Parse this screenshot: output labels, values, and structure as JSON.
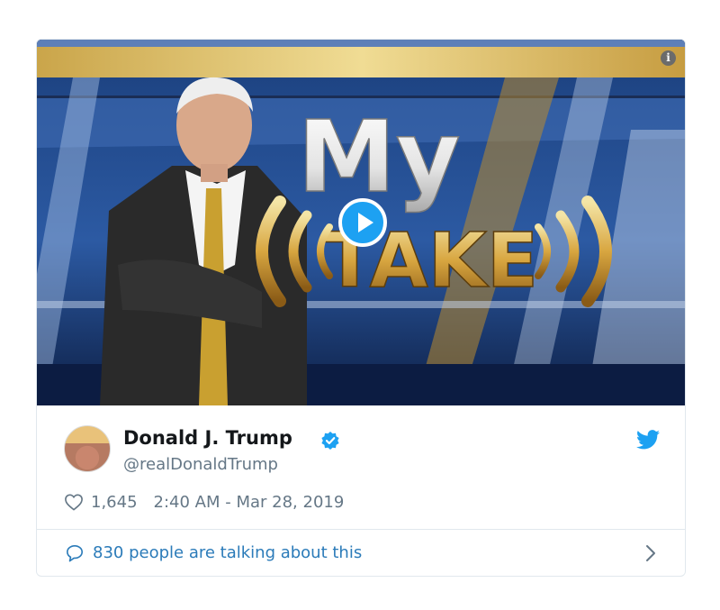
{
  "media": {
    "title_line1": "My",
    "title_line2": "TAKE",
    "info_icon": "info-icon",
    "play_icon": "play-icon"
  },
  "tweet": {
    "name": "Donald J. Trump",
    "handle": "@realDonaldTrump",
    "verified": true,
    "likes": "1,645",
    "timestamp": "2:40 AM - Mar 28, 2019",
    "footer": "830 people are talking about this"
  },
  "colors": {
    "twitter_blue": "#1da1f2",
    "link_blue": "#2b7bb9",
    "gray_text": "#657786"
  }
}
